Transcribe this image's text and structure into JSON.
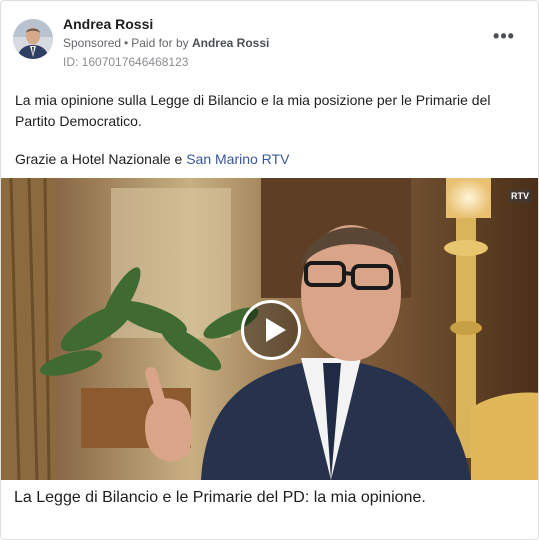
{
  "post": {
    "author": "Andrea Rossi",
    "sponsored": "Sponsored",
    "separator": "•",
    "paid_for_prefix": "Paid for by",
    "paid_for_name": "Andrea Rossi",
    "id_line": "ID: 1607017646468123",
    "more_label": "•••",
    "text": "La mia opinione sulla Legge di Bilancio e la mia posizione per le Primarie del Partito Democratico.",
    "thanks_prefix": "Grazie a Hotel Nazionale e ",
    "thanks_link": "San Marino RTV"
  },
  "video": {
    "overlay_logo": "RTV",
    "caption": "La Legge di Bilancio e le Primarie del PD: la mia opinione."
  },
  "icons": {
    "more": "more-options-icon",
    "play": "play-icon"
  },
  "colors": {
    "link": "#385898",
    "secondary_text": "#65676b",
    "border": "#dddfe2"
  }
}
